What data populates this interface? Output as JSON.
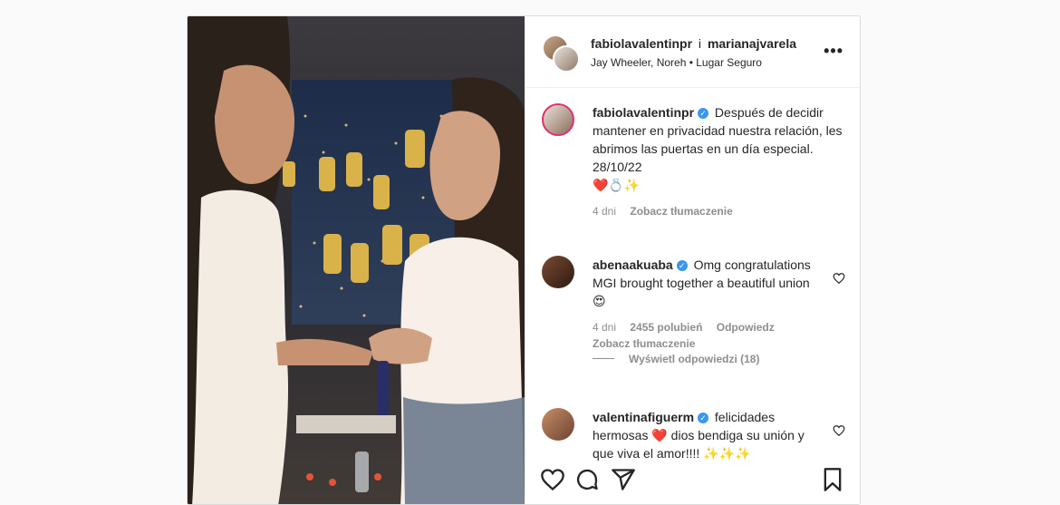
{
  "post": {
    "header": {
      "user1": "fabiolavalentinpr",
      "joiner": "i",
      "user2": "marianajvarela",
      "audio": "Jay Wheeler, Noreh • Lugar Seguro",
      "more_label": "•••"
    },
    "caption": {
      "user": "fabiolavalentinpr",
      "text": "Después de decidir mantener en privacidad nuestra relación, les abrimos las puertas en un día especial. 28/10/22",
      "emoji": "❤️💍✨",
      "time": "4 dni",
      "translate": "Zobacz tłumaczenie"
    },
    "comments": [
      {
        "user": "abenaakuaba",
        "text": "Omg congratulations MGI brought together a beautiful union 😍",
        "time": "4 dni",
        "likes": "2455 polubień",
        "reply": "Odpowiedz",
        "translate": "Zobacz tłumaczenie"
      },
      {
        "user": "valentinafiguerm",
        "text": "felicidades hermosas ❤️ dios bendiga su unión y que viva el amor!!!! ✨✨✨"
      }
    ],
    "view_replies": "Wyświetl odpowiedzi (18)",
    "colors": {
      "verified": "#3897f0",
      "muted": "#8e8e8e",
      "text": "#262626"
    },
    "icons": [
      "heart-icon",
      "comment-icon",
      "share-icon",
      "bookmark-icon",
      "more-icon",
      "verified-icon"
    ]
  }
}
